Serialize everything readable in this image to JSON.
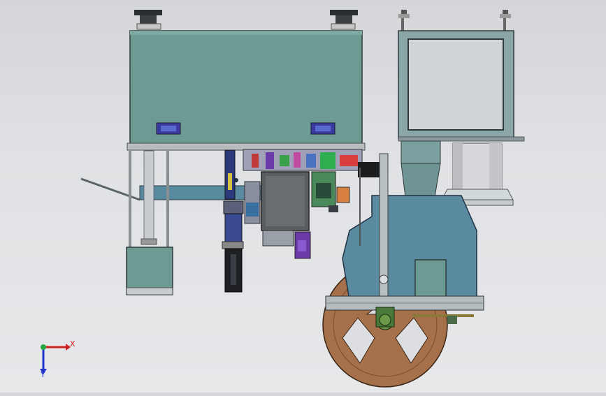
{
  "triad": {
    "x_label": "X",
    "y_label": "Y"
  },
  "colors": {
    "background": "#dcdee1",
    "housing_teal": "#6e9a94",
    "frame_gray": "#8aa6a6",
    "reel_brown": "#a6704a",
    "slate_blue": "#5a8aa0",
    "handle_purple": "#6a3aa8",
    "triad_x": "#cc2222",
    "triad_y": "#2233cc",
    "triad_origin": "#22aa44"
  },
  "icons": [
    "coordinate-triad-icon"
  ]
}
